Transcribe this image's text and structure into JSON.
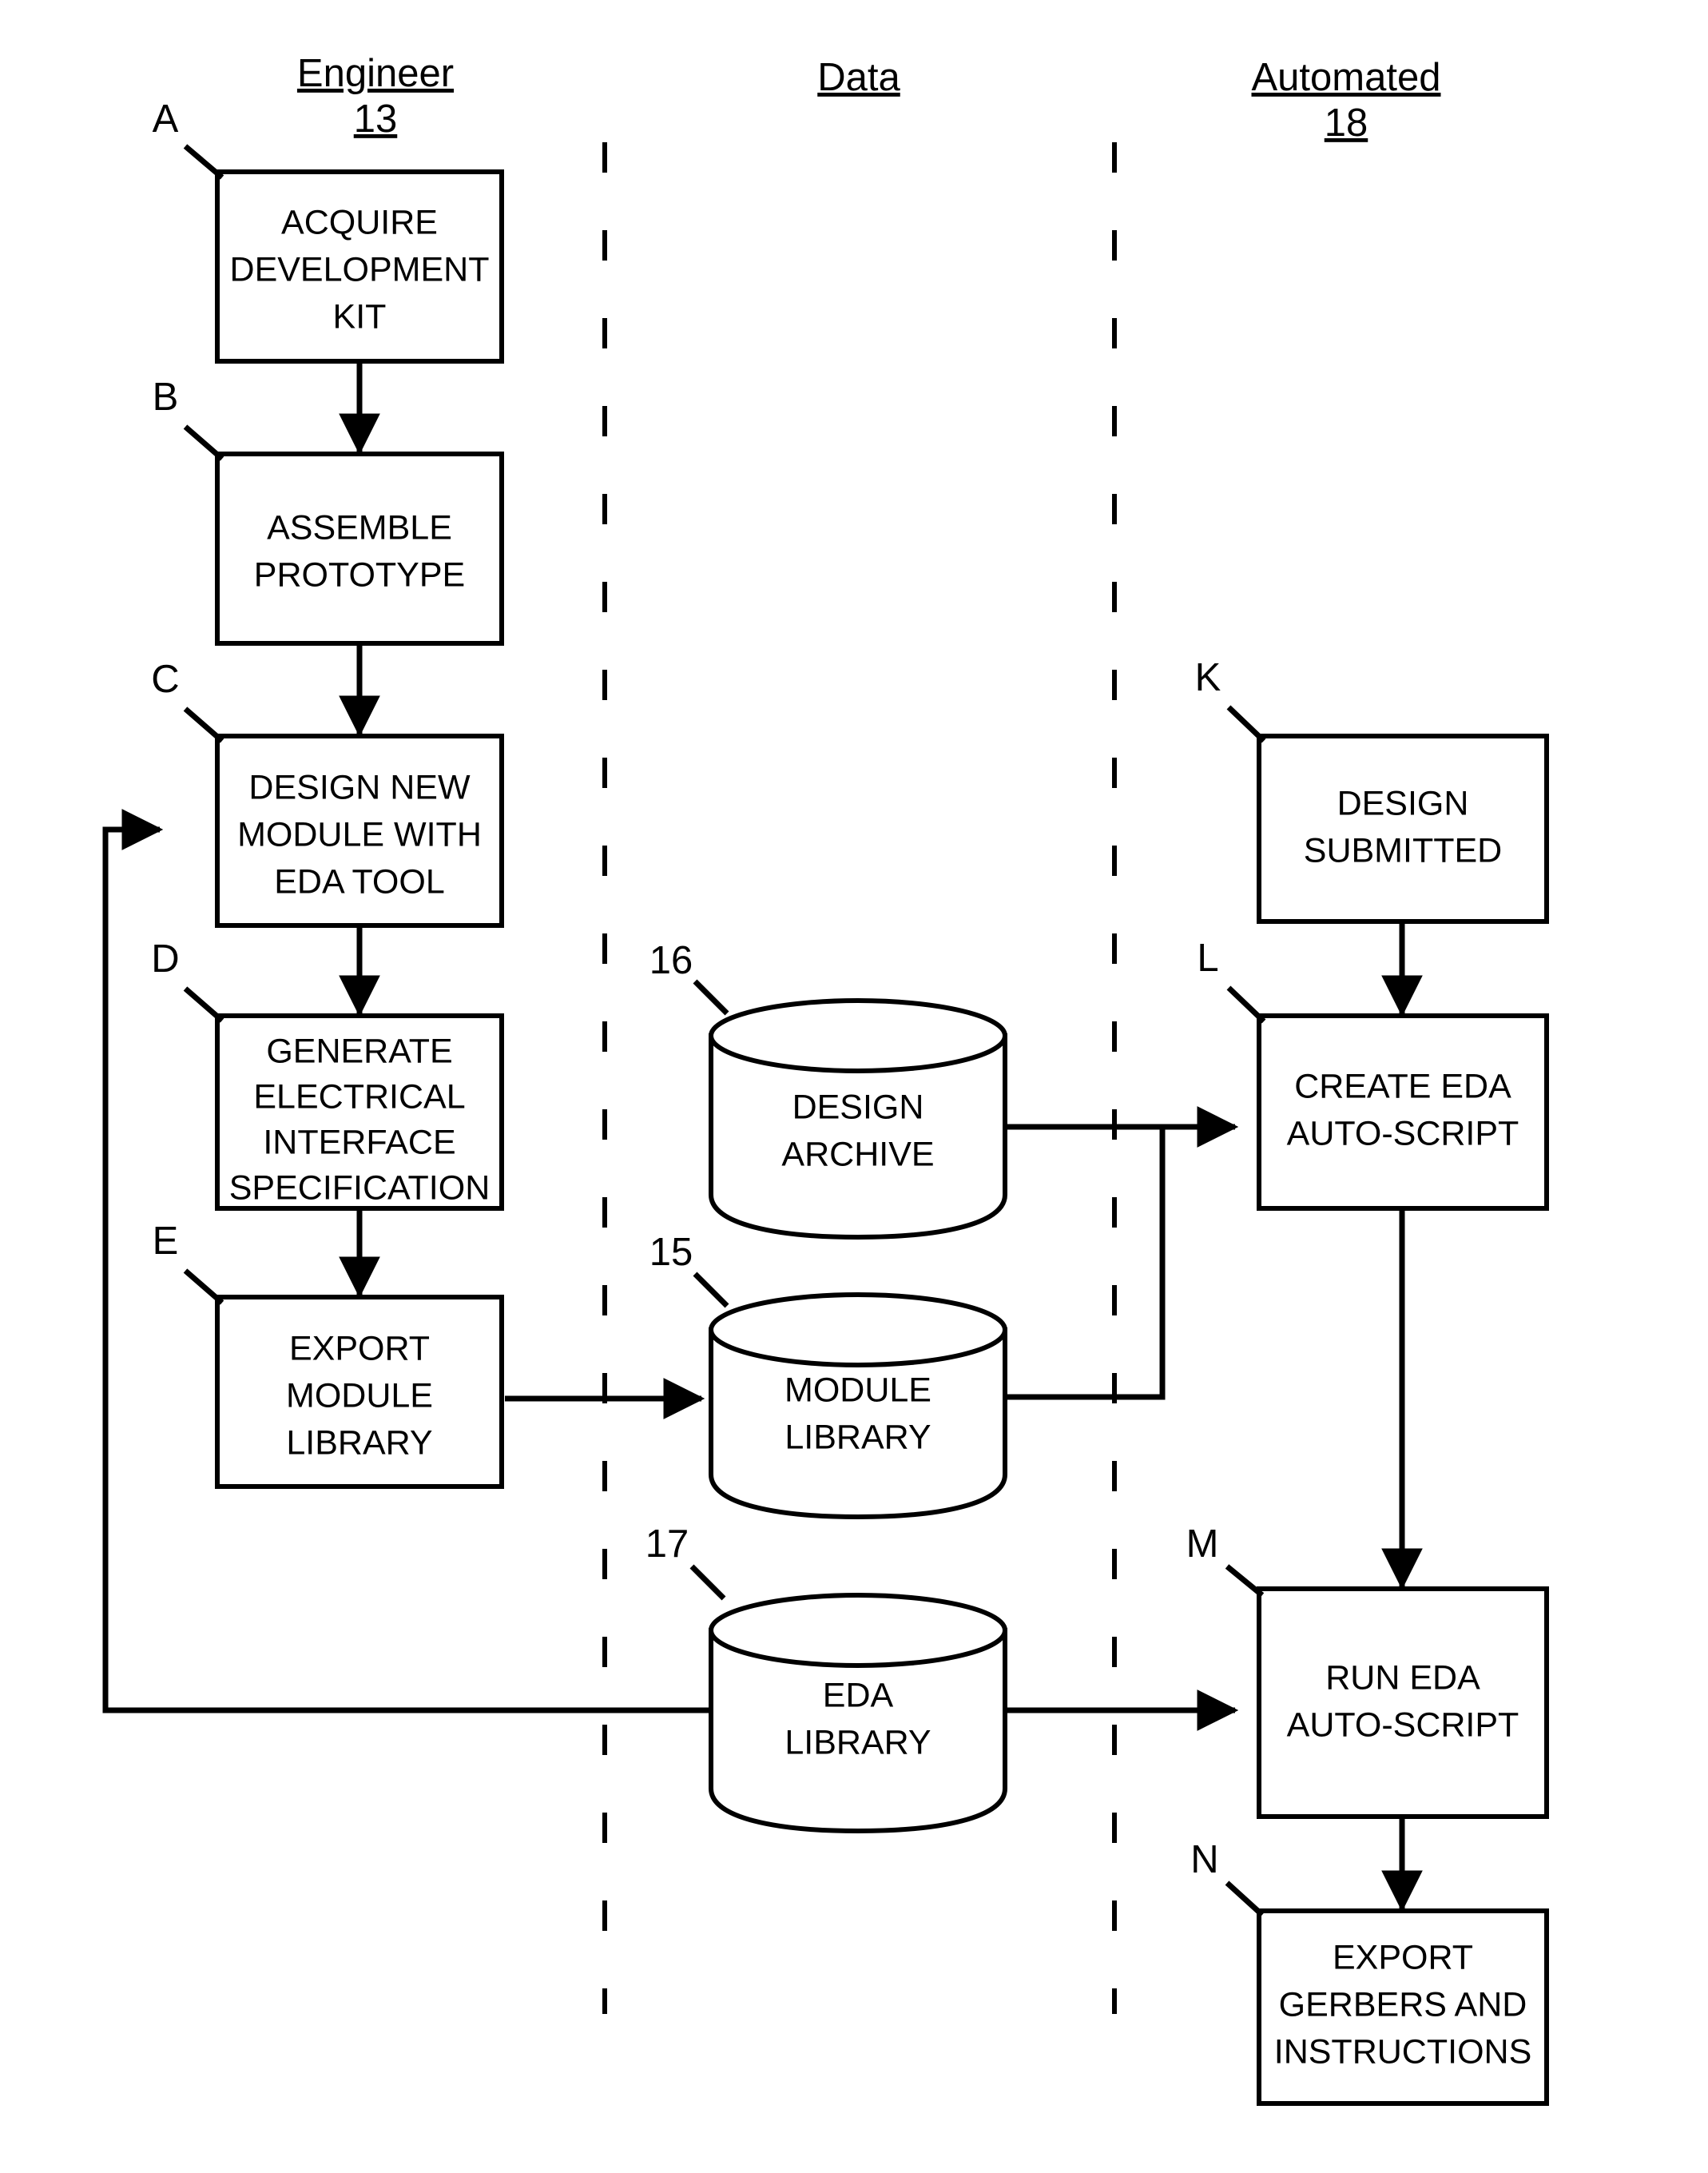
{
  "figure": {
    "kind": "patent-flowchart",
    "background_color": "#ffffff",
    "line_color": "#000000"
  },
  "lanes": [
    {
      "id": "engineer",
      "title": "Engineer",
      "number": "13"
    },
    {
      "id": "data",
      "title": "Data",
      "number": ""
    },
    {
      "id": "automated",
      "title": "Automated",
      "number": "18"
    }
  ],
  "process_boxes": [
    {
      "ref": "A",
      "lines": [
        "ACQUIRE",
        "DEVELOPMENT",
        "KIT"
      ],
      "lane": "engineer"
    },
    {
      "ref": "B",
      "lines": [
        "ASSEMBLE",
        "PROTOTYPE"
      ],
      "lane": "engineer"
    },
    {
      "ref": "C",
      "lines": [
        "DESIGN NEW",
        "MODULE WITH",
        "EDA TOOL"
      ],
      "lane": "engineer"
    },
    {
      "ref": "D",
      "lines": [
        "GENERATE",
        "ELECTRICAL",
        "INTERFACE",
        "SPECIFICATION"
      ],
      "lane": "engineer"
    },
    {
      "ref": "E",
      "lines": [
        "EXPORT",
        "MODULE",
        "LIBRARY"
      ],
      "lane": "engineer"
    },
    {
      "ref": "K",
      "lines": [
        "DESIGN",
        "SUBMITTED"
      ],
      "lane": "automated"
    },
    {
      "ref": "L",
      "lines": [
        "CREATE EDA",
        "AUTO-SCRIPT"
      ],
      "lane": "automated"
    },
    {
      "ref": "M",
      "lines": [
        "RUN EDA",
        "AUTO-SCRIPT"
      ],
      "lane": "automated"
    },
    {
      "ref": "N",
      "lines": [
        "EXPORT",
        "GERBERS AND",
        "INSTRUCTIONS"
      ],
      "lane": "automated"
    }
  ],
  "datastores": [
    {
      "ref": "16",
      "lines": [
        "DESIGN",
        "ARCHIVE"
      ],
      "lane": "data"
    },
    {
      "ref": "15",
      "lines": [
        "MODULE",
        "LIBRARY"
      ],
      "lane": "data"
    },
    {
      "ref": "17",
      "lines": [
        "EDA",
        "LIBRARY"
      ],
      "lane": "data"
    }
  ],
  "connections": [
    {
      "from": "A",
      "to": "B",
      "style": "arrow-down"
    },
    {
      "from": "B",
      "to": "C",
      "style": "arrow-down"
    },
    {
      "from": "C",
      "to": "D",
      "style": "arrow-down"
    },
    {
      "from": "D",
      "to": "E",
      "style": "arrow-down"
    },
    {
      "from": "E",
      "to": "15",
      "style": "arrow-right"
    },
    {
      "from": "16",
      "to": "L",
      "style": "arrow-right"
    },
    {
      "from": "15",
      "to": "L",
      "style": "arrow-right-joined"
    },
    {
      "from": "17",
      "to": "M",
      "style": "arrow-right"
    },
    {
      "from": "17",
      "to": "C",
      "style": "feedback-loop-left"
    },
    {
      "from": "K",
      "to": "L",
      "style": "arrow-down"
    },
    {
      "from": "L",
      "to": "M",
      "style": "arrow-down"
    },
    {
      "from": "M",
      "to": "N",
      "style": "arrow-down"
    }
  ]
}
